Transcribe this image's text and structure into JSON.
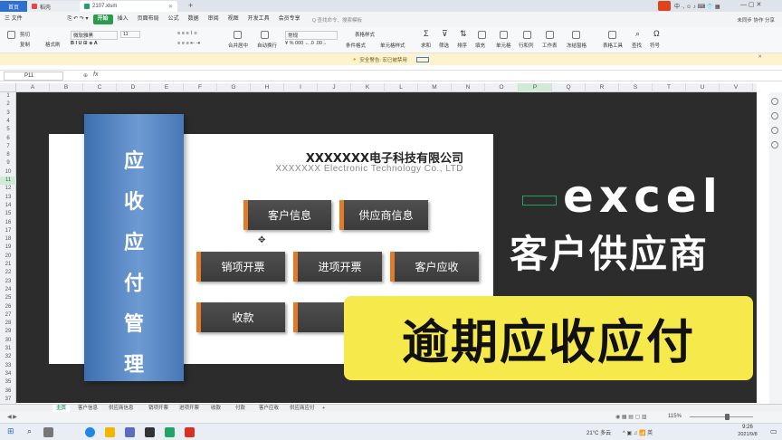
{
  "tabs": {
    "home": "首页",
    "tab2": "稻壳",
    "tab3": "2107.xlsm",
    "add": "+"
  },
  "menu": [
    "三 文件",
    "开始",
    "插入",
    "页面布局",
    "公式",
    "数据",
    "审阅",
    "视图",
    "开发工具",
    "会员专享"
  ],
  "menu_active_index": 1,
  "search_placeholder": "Q 查找命令、搜索模板",
  "titlebar_right": {
    "cooperate": "未同步",
    "share": "协作",
    "share2": "分享"
  },
  "ribbon": {
    "clipboard": [
      "剪切",
      "复制",
      "格式刷"
    ],
    "font_name": "微软雅黑",
    "font_size": "11",
    "align_labels": [
      "合并居中",
      "自动换行"
    ],
    "number_format": "常规",
    "right_labels": [
      "表格样式",
      "条件格式",
      "单元格样式",
      "求和",
      "筛选",
      "排序",
      "填充",
      "单元格",
      "行和列",
      "工作表",
      "冻结窗格",
      "表格工具",
      "查找",
      "符号"
    ]
  },
  "warning": {
    "text": "安全警告: 宏已被禁用",
    "action": "启用宏"
  },
  "formula": {
    "namebox": "P11",
    "fx": "fx"
  },
  "columns": [
    "A",
    "B",
    "C",
    "D",
    "E",
    "F",
    "G",
    "H",
    "I",
    "J",
    "K",
    "L",
    "M",
    "N",
    "O",
    "P",
    "Q",
    "R",
    "S",
    "T",
    "U",
    "V"
  ],
  "selected_column": "P",
  "rows": [
    "1",
    "2",
    "3",
    "4",
    "5",
    "6",
    "7",
    "8",
    "9",
    "10",
    "11",
    "12",
    "13",
    "14",
    "15",
    "16",
    "17",
    "18",
    "19",
    "20",
    "21",
    "22",
    "23",
    "24",
    "25",
    "26",
    "27",
    "28",
    "29",
    "30",
    "31",
    "32",
    "33",
    "34",
    "35",
    "36",
    "37"
  ],
  "sidebar_chars": [
    "应",
    "收",
    "应",
    "付",
    "管",
    "理"
  ],
  "company": {
    "cn": "XXXXXXX电子科技有限公司",
    "en": "XXXXXXX Electronic Technology Co., LTD"
  },
  "buttons": {
    "customer_info": "客户信息",
    "supplier_info": "供应商信息",
    "sales_invoice": "销项开票",
    "purchase_invoice": "进项开票",
    "customer_receivable": "客户应收",
    "collection": "收款"
  },
  "overlay": {
    "line1": "excel",
    "line2": "客户供应商",
    "line3": "逾期应收应付"
  },
  "sheet_tabs": [
    "主页",
    "客户信息",
    "供应商信息",
    "销项开票",
    "进项开票",
    "收款",
    "付款",
    "客户应收",
    "供应商应付",
    "+"
  ],
  "active_sheet": "主页",
  "status": {
    "zoom": "115%"
  },
  "taskbar": {
    "weather": "21°C 多云",
    "time": "9:26",
    "date": "2021/9/8"
  },
  "colors": {
    "accent": "#2b9a4b",
    "sidebar": "#4a7fc1",
    "button": "#454545",
    "button_accent": "#e07b2a",
    "highlight": "#f6e94b"
  }
}
